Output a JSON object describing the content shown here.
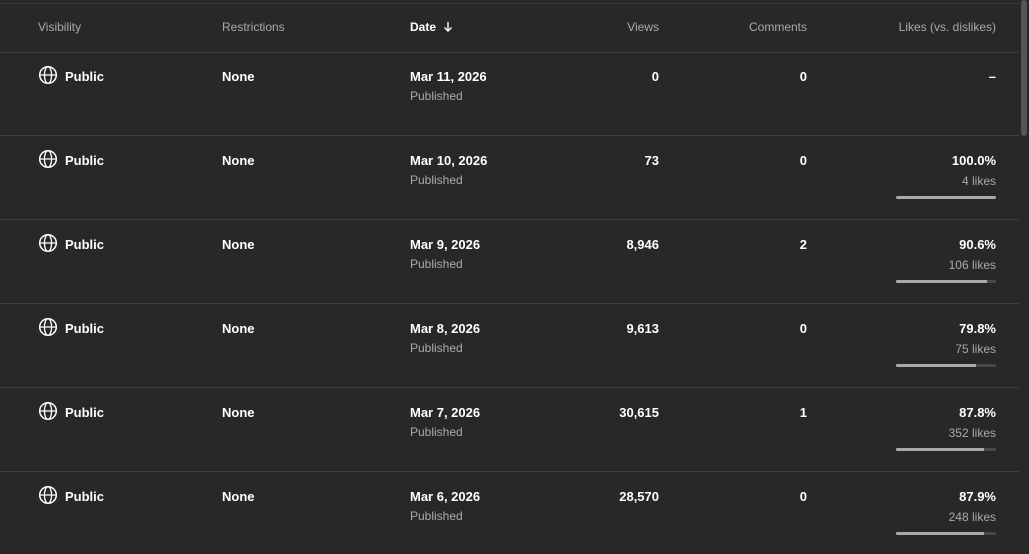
{
  "header": {
    "visibility": "Visibility",
    "restrictions": "Restrictions",
    "date": "Date",
    "views": "Views",
    "comments": "Comments",
    "likes": "Likes (vs. dislikes)"
  },
  "colors": {
    "background": "#282828",
    "divider": "#3e3e3e",
    "muted_text": "#aaaaaa",
    "bar_track": "#4a4a4a",
    "bar_fill": "#aaaaaa"
  },
  "rows": [
    {
      "visibility": "Public",
      "visibility_icon": "globe-icon",
      "restrictions": "None",
      "date": "Mar 11, 2026",
      "status": "Published",
      "views": "0",
      "comments": "0",
      "likes_pct": "–",
      "likes_count": "",
      "likes_ratio": null
    },
    {
      "visibility": "Public",
      "visibility_icon": "globe-icon",
      "restrictions": "None",
      "date": "Mar 10, 2026",
      "status": "Published",
      "views": "73",
      "comments": "0",
      "likes_pct": "100.0%",
      "likes_count": "4 likes",
      "likes_ratio": 1.0
    },
    {
      "visibility": "Public",
      "visibility_icon": "globe-icon",
      "restrictions": "None",
      "date": "Mar 9, 2026",
      "status": "Published",
      "views": "8,946",
      "comments": "2",
      "likes_pct": "90.6%",
      "likes_count": "106 likes",
      "likes_ratio": 0.906
    },
    {
      "visibility": "Public",
      "visibility_icon": "globe-icon",
      "restrictions": "None",
      "date": "Mar 8, 2026",
      "status": "Published",
      "views": "9,613",
      "comments": "0",
      "likes_pct": "79.8%",
      "likes_count": "75 likes",
      "likes_ratio": 0.798
    },
    {
      "visibility": "Public",
      "visibility_icon": "globe-icon",
      "restrictions": "None",
      "date": "Mar 7, 2026",
      "status": "Published",
      "views": "30,615",
      "comments": "1",
      "likes_pct": "87.8%",
      "likes_count": "352 likes",
      "likes_ratio": 0.878
    },
    {
      "visibility": "Public",
      "visibility_icon": "globe-icon",
      "restrictions": "None",
      "date": "Mar 6, 2026",
      "status": "Published",
      "views": "28,570",
      "comments": "0",
      "likes_pct": "87.9%",
      "likes_count": "248 likes",
      "likes_ratio": 0.879
    }
  ]
}
